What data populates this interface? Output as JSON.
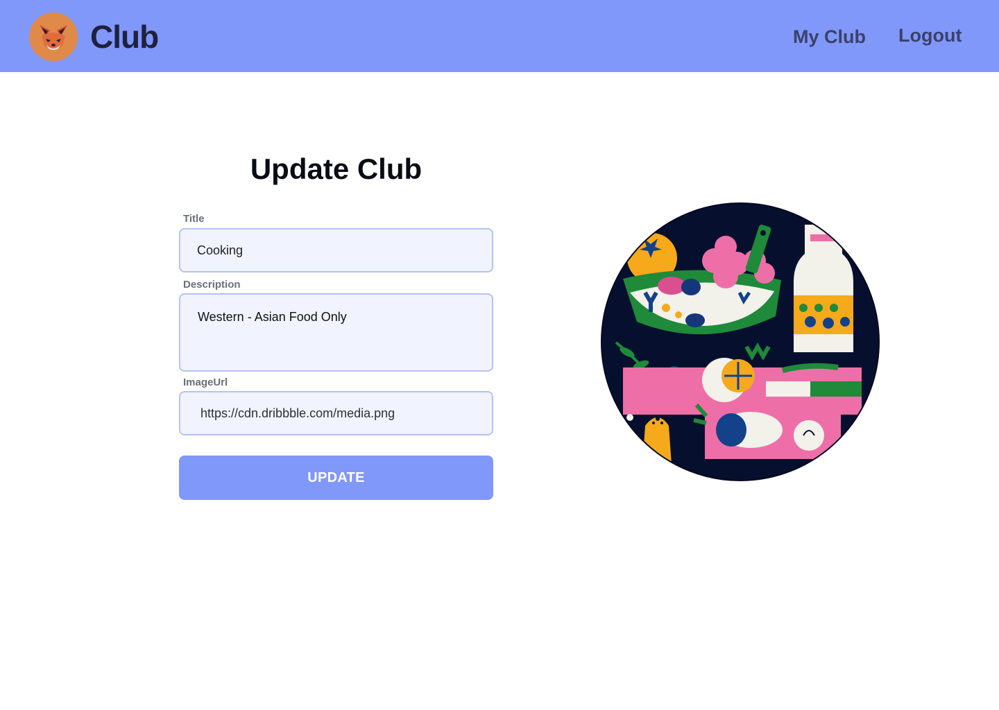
{
  "header": {
    "brand": "Club",
    "logo_icon": "fox-logo-icon",
    "nav": {
      "my_club": "My Club",
      "logout": "Logout"
    },
    "background_color": "#8098f9"
  },
  "form": {
    "heading": "Update Club",
    "fields": {
      "title": {
        "label": "Title",
        "value": "Cooking"
      },
      "description": {
        "label": "Description",
        "value": "Western - Asian Food Only"
      },
      "image_url": {
        "label": "ImageUrl",
        "value": "https://cdn.dribbble.com/media.png"
      }
    },
    "submit_label": "UPDATE",
    "accent_color": "#8098f9"
  },
  "preview": {
    "image_description_icon": "food-illustration-image"
  }
}
